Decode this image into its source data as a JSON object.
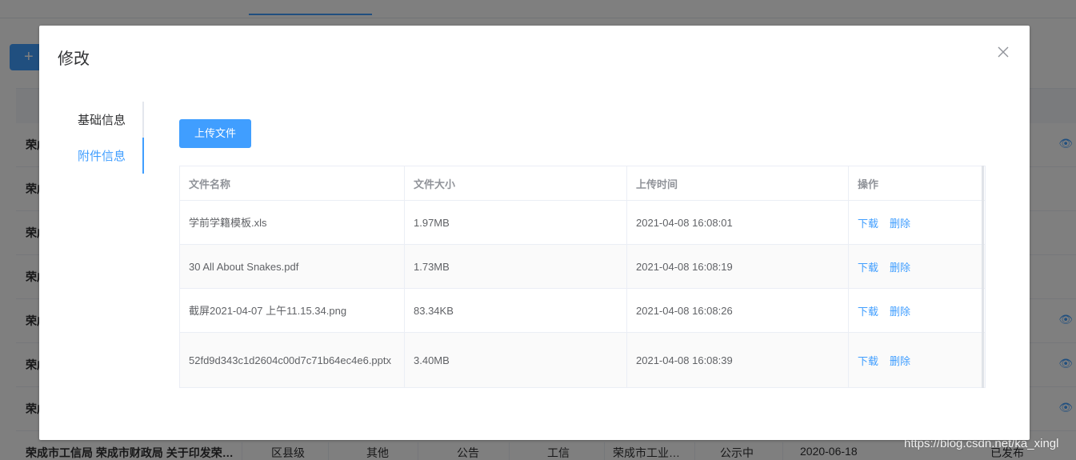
{
  "background": {
    "add_icon": "plus-icon",
    "eye_icon": "eye-icon",
    "last_row": {
      "title": "荣成市工信局 荣成市财政局 关于印发荣…",
      "level": "区县级",
      "category": "其他",
      "type": "公告",
      "industry": "工信",
      "department": "荣成市工业…",
      "status": "公示中",
      "date": "2020-06-18",
      "publish_status": "已发布"
    },
    "row_prefix": "荣成"
  },
  "watermark": "https://blog.csdn.net/ka_xingl",
  "dialog": {
    "title": "修改",
    "close_icon": "close-icon",
    "tabs": [
      {
        "label": "基础信息",
        "active": false
      },
      {
        "label": "附件信息",
        "active": true
      }
    ],
    "upload_button": "上传文件",
    "table": {
      "headers": [
        "文件名称",
        "文件大小",
        "上传时间",
        "操作"
      ],
      "rows": [
        {
          "name": "学前学籍模板.xls",
          "size": "1.97MB",
          "time": "2021-04-08 16:08:01"
        },
        {
          "name": "30 All About Snakes.pdf",
          "size": "1.73MB",
          "time": "2021-04-08 16:08:19"
        },
        {
          "name": "截屏2021-04-07 上午11.15.34.png",
          "size": "83.34KB",
          "time": "2021-04-08 16:08:26"
        },
        {
          "name": "52fd9d343c1d2604c00d7c71b64ec4e6.pptx",
          "size": "3.40MB",
          "time": "2021-04-08 16:08:39"
        }
      ],
      "actions": {
        "download": "下载",
        "delete": "删除"
      }
    }
  },
  "colors": {
    "primary": "#409eff",
    "overlay": "rgba(0,0,0,0.5)",
    "text": "#606266",
    "header_text": "#909399"
  }
}
